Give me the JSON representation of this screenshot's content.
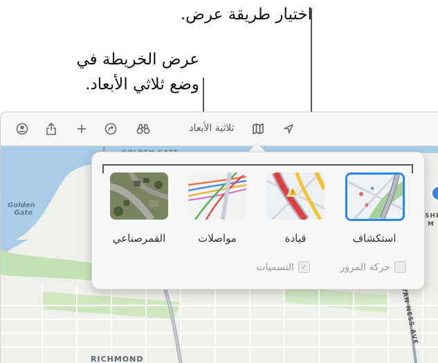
{
  "callouts": {
    "choose_view": "اختيار طريقة عرض.",
    "view_3d_line1": "عرض الخريطة في",
    "view_3d_line2": "وضع ثلاثي الأبعاد."
  },
  "toolbar": {
    "three_d_label": "ثلاثية الأبعاد",
    "icons": [
      "account-icon",
      "share-icon",
      "plus-icon",
      "route-arrow-icon",
      "binoculars-icon",
      "map-icon",
      "location-arrow-icon"
    ]
  },
  "map": {
    "labels": {
      "golden_gate_top": "GOLDEN GATE",
      "golden_gate_line1": "Golden",
      "golden_gate_line2": "Gate",
      "richmond": "RICHMOND",
      "van_ness": "VAN NESS AVE",
      "she": "SHE",
      "m": "M"
    }
  },
  "map_types": [
    {
      "label": "استكشاف",
      "selected": true
    },
    {
      "label": "قيادة",
      "selected": false
    },
    {
      "label": "مواصلات",
      "selected": false
    },
    {
      "label": "القمرصناعي",
      "selected": false
    }
  ],
  "options": {
    "traffic": {
      "label": "حركة المرور",
      "checked": false
    },
    "labels": {
      "label": "التسميات",
      "checked": true
    }
  },
  "colors": {
    "accent": "#2a87f2",
    "driving_red": "#e23b3b",
    "driving_yellow": "#f5c431"
  }
}
